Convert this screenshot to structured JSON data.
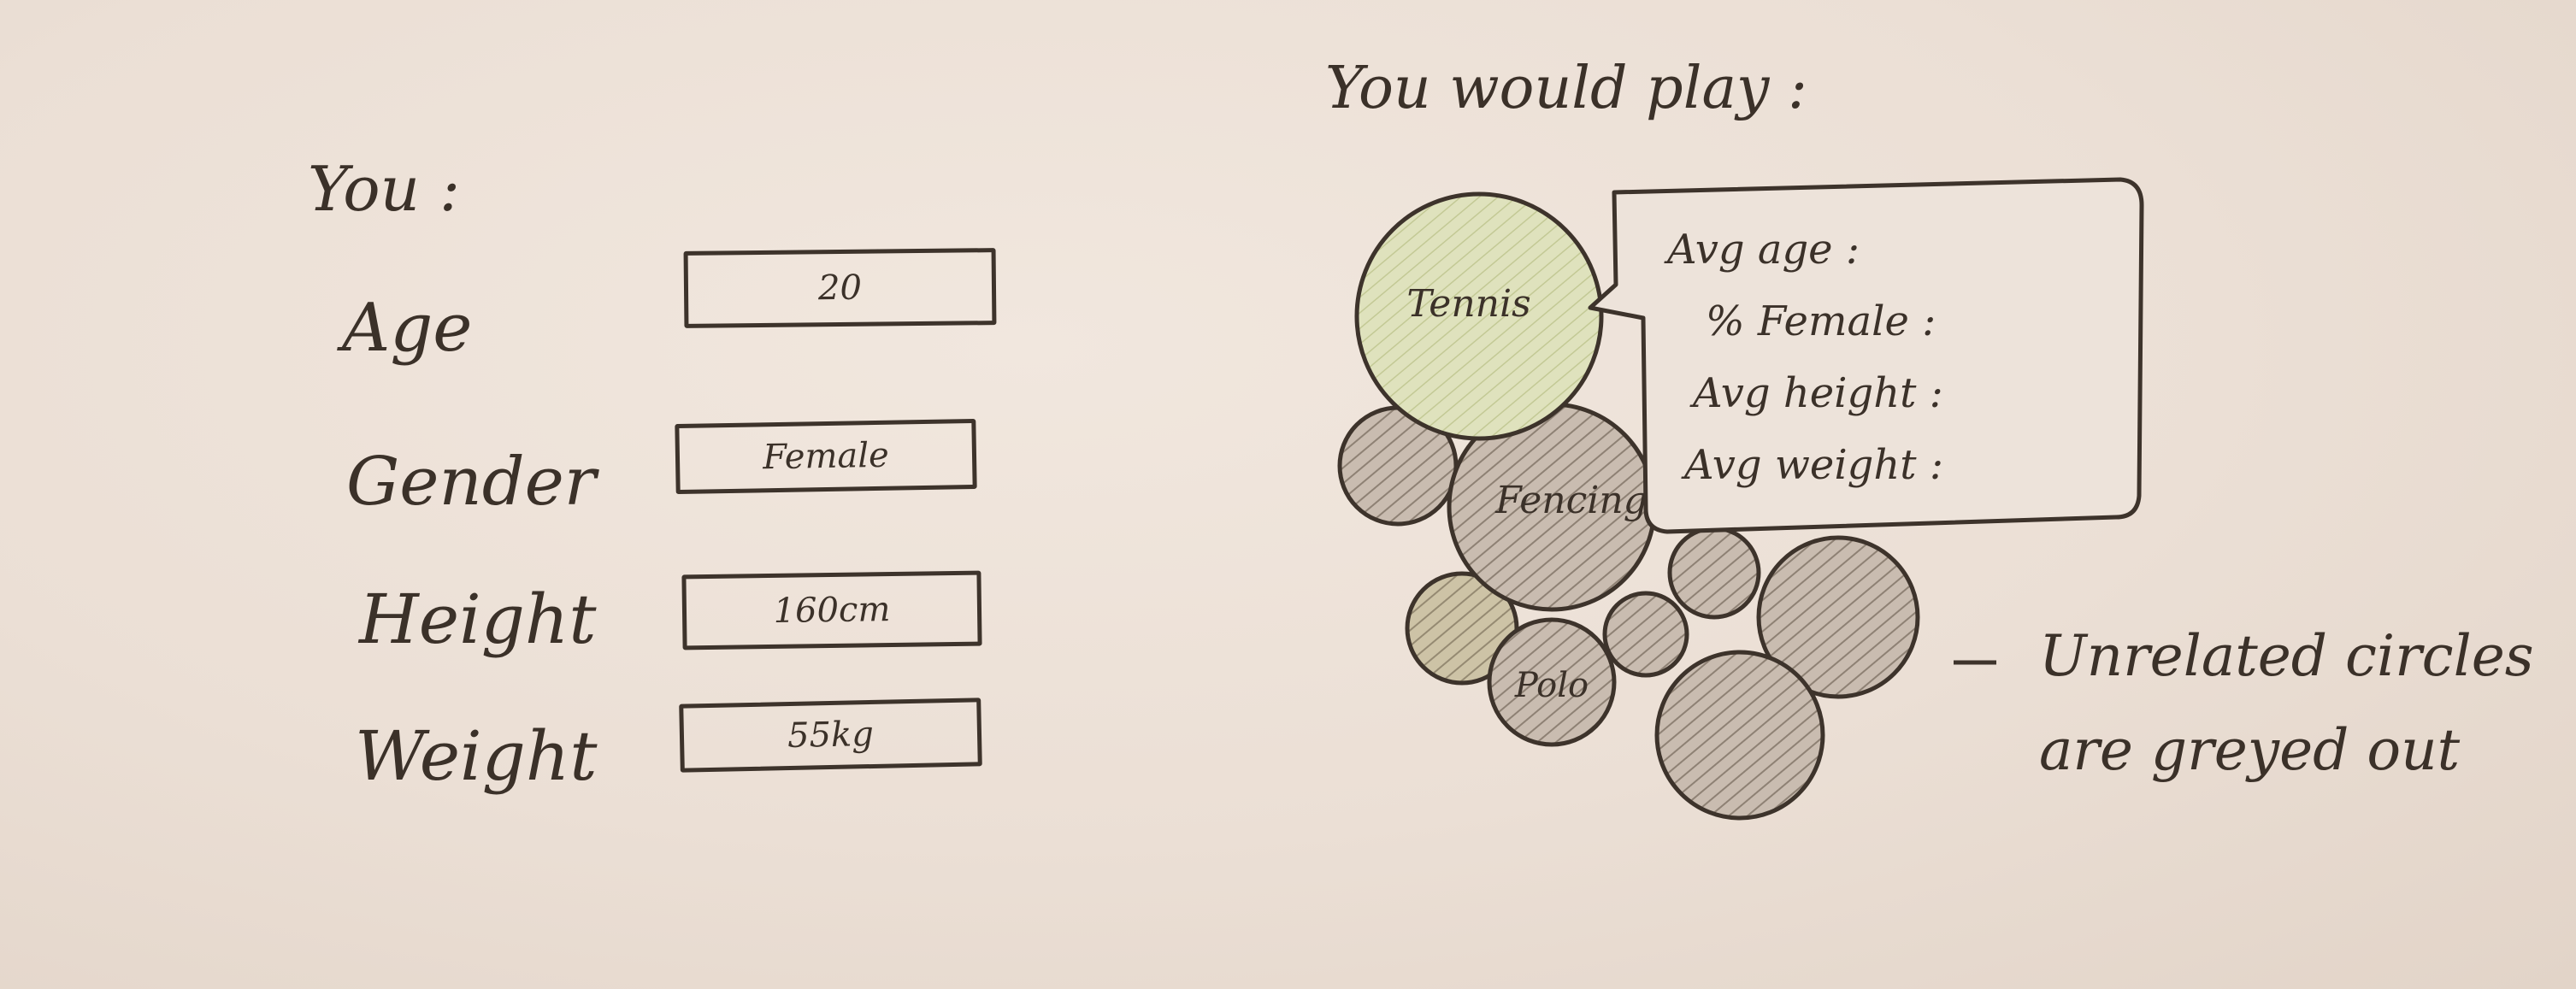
{
  "you_section": {
    "title": "You :",
    "fields": [
      {
        "label": "Age",
        "value": "20"
      },
      {
        "label": "Gender",
        "value": "Female"
      },
      {
        "label": "Height",
        "value": "160cm"
      },
      {
        "label": "Weight",
        "value": "55kg"
      }
    ]
  },
  "play_section": {
    "title": "You would play :",
    "bubbles": [
      {
        "label": "Tennis",
        "state": "highlighted"
      },
      {
        "label": "Fencing",
        "state": "highlighted"
      },
      {
        "label": "Polo",
        "state": "related"
      }
    ],
    "tooltip": {
      "lines": [
        "Avg age :",
        "% Female :",
        "Avg height :",
        "Avg weight :"
      ]
    },
    "annotation": {
      "line1": "Unrelated circles",
      "line2": "are greyed out"
    }
  },
  "colors": {
    "paper": "#ece1d8",
    "ink": "#3d332b",
    "highlight_green": "#d9dfb4",
    "grey_hatch": "#a89b8e"
  }
}
